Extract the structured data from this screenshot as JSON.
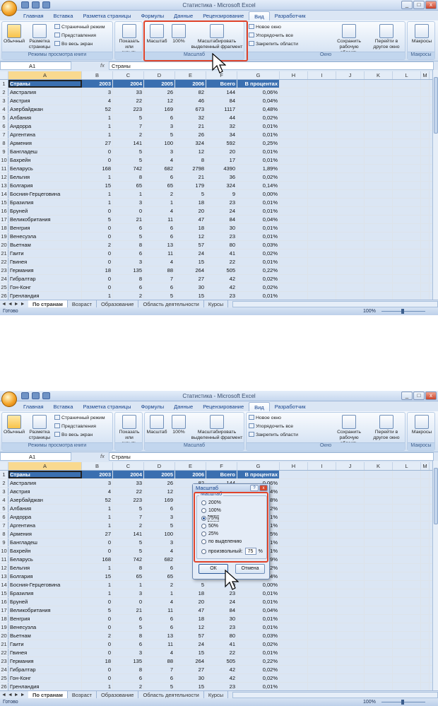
{
  "app": {
    "window_title": "Статистика - Microsoft Excel"
  },
  "tabs": [
    "Главная",
    "Вставка",
    "Разметка страницы",
    "Формулы",
    "Данные",
    "Рецензирование",
    "Вид",
    "Разработчик"
  ],
  "ribbon": {
    "g1": {
      "normal": "Обычный",
      "layout": "Разметка страницы",
      "page_mode": "Страничный режим",
      "views": "Представления",
      "fullscreen": "Во весь экран",
      "label": "Режимы просмотра книги"
    },
    "g2": {
      "show": "Показать или скрыть"
    },
    "g3": {
      "zoom": "Масштаб",
      "p100": "100%",
      "fit": "Масштабировать выделенный фрагмент",
      "label": "Масштаб"
    },
    "g4": {
      "new_window": "Новое окно",
      "arrange": "Упорядочить все",
      "freeze": "Закрепить области",
      "save_ws": "Сохранить рабочую область",
      "switch": "Перейти в другое окно",
      "label": "Окно"
    },
    "g5": {
      "macros": "Макросы",
      "label": "Макросы"
    }
  },
  "formula": {
    "name_box": "A1",
    "fx": "fx",
    "value": "Страны"
  },
  "columns": [
    "A",
    "B",
    "C",
    "D",
    "E",
    "F",
    "G",
    "H",
    "I",
    "J",
    "K",
    "L",
    "M"
  ],
  "header_row": [
    "Страны",
    "2003",
    "2004",
    "2005",
    "2006",
    "Всего",
    "В процентах"
  ],
  "rows": [
    [
      "Австралия",
      "3",
      "33",
      "26",
      "82",
      "144",
      "0,06%"
    ],
    [
      "Австрия",
      "4",
      "22",
      "12",
      "46",
      "84",
      "0,04%"
    ],
    [
      "Азербайджан",
      "52",
      "223",
      "169",
      "673",
      "1117",
      "0,48%"
    ],
    [
      "Албания",
      "1",
      "5",
      "6",
      "32",
      "44",
      "0,02%"
    ],
    [
      "Андорра",
      "1",
      "7",
      "3",
      "21",
      "32",
      "0,01%"
    ],
    [
      "Аргентина",
      "1",
      "2",
      "5",
      "26",
      "34",
      "0,01%"
    ],
    [
      "Армения",
      "27",
      "141",
      "100",
      "324",
      "592",
      "0,25%"
    ],
    [
      "Бангладеш",
      "0",
      "5",
      "3",
      "12",
      "20",
      "0,01%"
    ],
    [
      "Бахрейн",
      "0",
      "5",
      "4",
      "8",
      "17",
      "0,01%"
    ],
    [
      "Беларусь",
      "168",
      "742",
      "682",
      "2798",
      "4390",
      "1,89%"
    ],
    [
      "Бельгия",
      "1",
      "8",
      "6",
      "21",
      "36",
      "0,02%"
    ],
    [
      "Болгария",
      "15",
      "65",
      "65",
      "179",
      "324",
      "0,14%"
    ],
    [
      "Босния-Герцеговина",
      "1",
      "1",
      "2",
      "5",
      "9",
      "0,00%"
    ],
    [
      "Бразилия",
      "1",
      "3",
      "1",
      "18",
      "23",
      "0,01%"
    ],
    [
      "Бруней",
      "0",
      "0",
      "4",
      "20",
      "24",
      "0,01%"
    ],
    [
      "Великобритания",
      "5",
      "21",
      "11",
      "47",
      "84",
      "0,04%"
    ],
    [
      "Венгрия",
      "0",
      "6",
      "6",
      "18",
      "30",
      "0,01%"
    ],
    [
      "Венесуэла",
      "0",
      "5",
      "6",
      "12",
      "23",
      "0,01%"
    ],
    [
      "Вьетнам",
      "2",
      "8",
      "13",
      "57",
      "80",
      "0,03%"
    ],
    [
      "Гаити",
      "0",
      "6",
      "11",
      "24",
      "41",
      "0,02%"
    ],
    [
      "Гвинея",
      "0",
      "3",
      "4",
      "15",
      "22",
      "0,01%"
    ],
    [
      "Германия",
      "18",
      "135",
      "88",
      "264",
      "505",
      "0,22%"
    ],
    [
      "Гибралтар",
      "0",
      "8",
      "7",
      "27",
      "42",
      "0,02%"
    ],
    [
      "Гон-Конг",
      "0",
      "6",
      "6",
      "30",
      "42",
      "0,02%"
    ],
    [
      "Гренландия",
      "1",
      "2",
      "5",
      "15",
      "23",
      "0,01%"
    ]
  ],
  "sheets": {
    "nav": "◄ ◄ ► ►",
    "items": [
      "По странам",
      "Возраст",
      "Образование",
      "Область деятельности",
      "Курсы"
    ]
  },
  "status": {
    "ready": "Готово",
    "zoom": "100%"
  },
  "dialog": {
    "title": "Масштаб",
    "group": "Масштаб",
    "options": [
      "200%",
      "100%",
      "75%",
      "50%",
      "25%",
      "по выделению",
      "произвольный:"
    ],
    "custom_value": "75",
    "custom_unit": "%",
    "ok": "ОК",
    "cancel": "Отмена",
    "help": "?"
  },
  "colors": {
    "accent_highlight": "#e0442b",
    "header_fill": "#3a6fb0"
  }
}
